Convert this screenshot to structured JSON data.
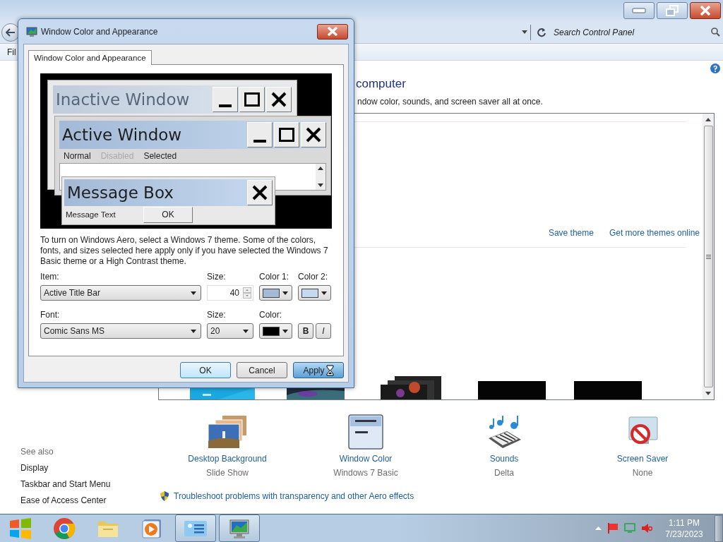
{
  "address_bar": {
    "search_placeholder": "Search Control Panel"
  },
  "menu_bar": [
    "Fil"
  ],
  "page": {
    "heading": "computer",
    "description": "ndow color, sounds, and screen saver all at once."
  },
  "theme_links": [
    "Save theme",
    "Get more themes online"
  ],
  "settings": [
    {
      "kind": "background",
      "label": "Desktop Background",
      "value": "Slide Show"
    },
    {
      "kind": "window",
      "label": "Window Color",
      "value": "Windows 7 Basic"
    },
    {
      "kind": "sounds",
      "label": "Sounds",
      "value": "Delta"
    },
    {
      "kind": "screensaver",
      "label": "Screen Saver",
      "value": "None"
    }
  ],
  "troubleshoot_link": "Troubleshoot problems with transparency and other Aero effects",
  "see_also": {
    "title": "See also",
    "links": [
      "Display",
      "Taskbar and Start Menu",
      "Ease of Access Center"
    ]
  },
  "taskbar": {
    "apps": [
      {
        "kind": "start",
        "open": false
      },
      {
        "kind": "browser",
        "open": false
      },
      {
        "kind": "folder",
        "open": false
      },
      {
        "kind": "media",
        "open": false
      },
      {
        "kind": "control-panel",
        "open": true
      },
      {
        "kind": "display",
        "open": true
      }
    ],
    "time": "1:11 PM",
    "date": "7/23/2023"
  },
  "dialog": {
    "title": "Window Color and Appearance",
    "tabs": [
      {
        "label": "Window Color and Appearance",
        "selected": true
      }
    ],
    "preview": {
      "inactive_title": "Inactive Window",
      "active_title": "Active Window",
      "menu": [
        {
          "label": "Normal",
          "disabled": false
        },
        {
          "label": "Disabled",
          "disabled": true
        },
        {
          "label": "Selected",
          "disabled": false
        }
      ],
      "message_title": "Message Box",
      "message_text": "Message Text",
      "message_button": "OK"
    },
    "note": "To turn on Windows Aero, select a Windows 7 theme.  Some of the colors, fonts, and sizes selected here apply only if you have selected the Windows 7 Basic theme or a High Contrast theme.",
    "form": {
      "item_label": "Item:",
      "item_value": "Active Title Bar",
      "size_label": "Size:",
      "size_value": "40",
      "color_pickers": [
        {
          "label": "Color 1:",
          "color": "#a3b9d6"
        },
        {
          "label": "Color 2:",
          "color": "#c6d9ef"
        },
        {
          "label": "Color:",
          "color": "#000000"
        }
      ],
      "font_label": "Font:",
      "font_value": "Comic Sans MS",
      "font_size_label": "Size:",
      "font_size_value": "20",
      "bold_label": "B",
      "bold": false,
      "italic_label": "I",
      "italic": false
    },
    "buttons": [
      {
        "label": "OK",
        "kind": "default"
      },
      {
        "label": "Cancel",
        "kind": "normal"
      },
      {
        "label": "Apply",
        "kind": "hot"
      }
    ]
  }
}
